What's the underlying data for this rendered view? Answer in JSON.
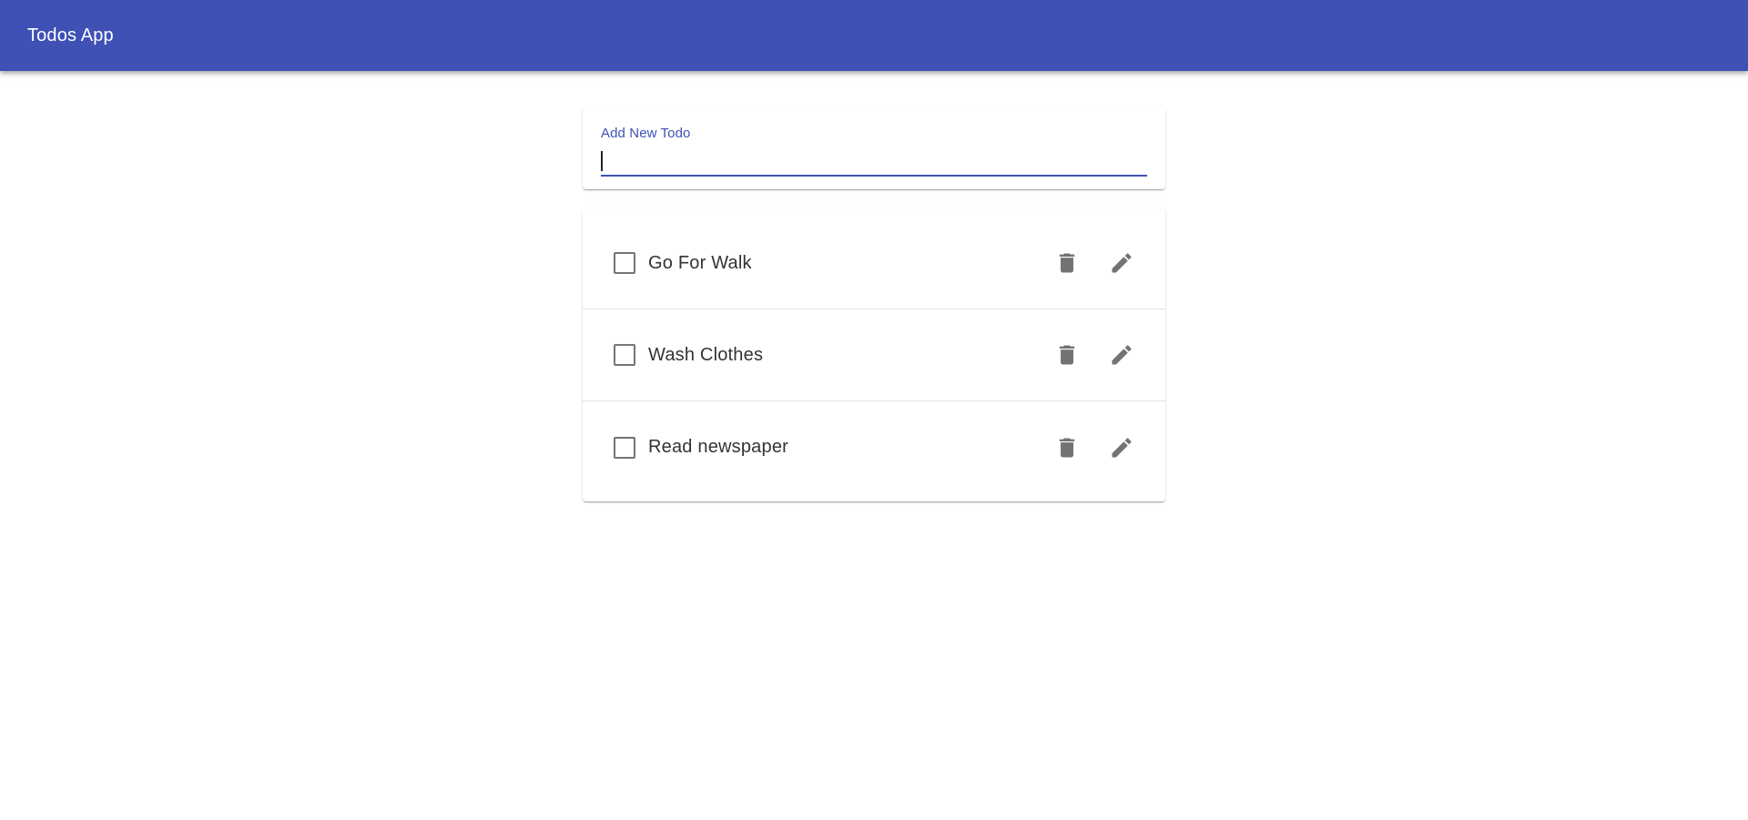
{
  "header": {
    "title": "Todos App",
    "background_color": "#3f51b5"
  },
  "form": {
    "label": "Add New Todo",
    "value": "",
    "placeholder": "",
    "accent_color": "#3f51b5"
  },
  "todos": [
    {
      "text": "Go For Walk",
      "completed": false,
      "delete_icon": "trash-icon",
      "edit_icon": "pencil-icon"
    },
    {
      "text": "Wash Clothes",
      "completed": false,
      "delete_icon": "trash-icon",
      "edit_icon": "pencil-icon"
    },
    {
      "text": "Read newspaper",
      "completed": false,
      "delete_icon": "trash-icon",
      "edit_icon": "pencil-icon"
    }
  ]
}
